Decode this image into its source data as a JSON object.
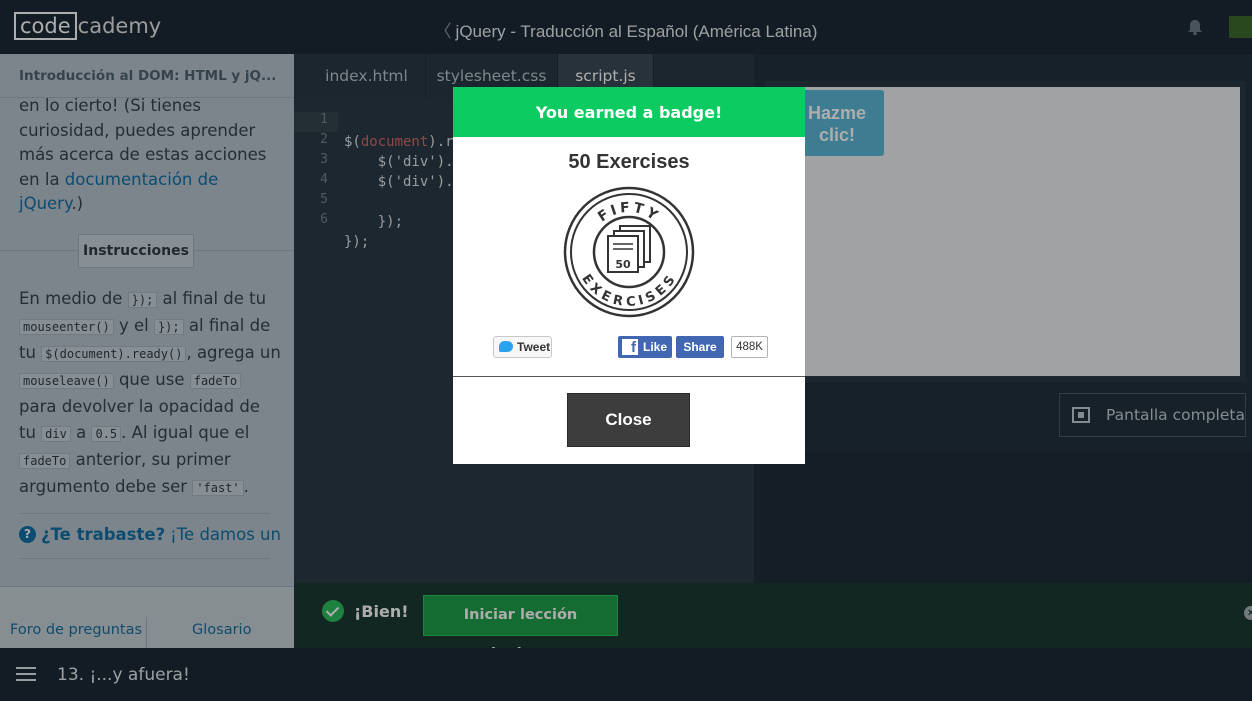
{
  "topbar": {
    "logo_left": "code",
    "logo_right": "cademy",
    "course_title": "jQuery - Traducción al Español (América Latina)",
    "back_chevron": "〈"
  },
  "left_panel": {
    "breadcrumb": "Introducción al DOM: HTML y jQ...",
    "para_text": "en lo cierto! (Si tienes curiosidad, puedes aprender más acerca de estas acciones en la ",
    "para_link": "documentación de jQuery",
    "para_end": ".)",
    "instructions_label": "Instrucciones",
    "instr": {
      "t1": "En medio de ",
      "c1": "});",
      "t2": " al final de tu ",
      "c2": "mouseenter()",
      "t3": " y el ",
      "c3": "});",
      "t4": " al final de tu ",
      "c4": "$(document).ready()",
      "t5": ", agrega un ",
      "c5": "mouseleave()",
      "t6": " que use ",
      "c6": "fadeTo",
      "t7": " para devolver la opacidad de tu ",
      "c7": "div",
      "t8": " a ",
      "c8": "0.5",
      "t9": ". Al igual que el ",
      "c9": "fadeTo",
      "t10": " anterior, su primer argumento debe ser ",
      "c10": "'fast'",
      "t11": "."
    },
    "hint_q": "?",
    "hint_bold": "¿Te trabaste?",
    "hint_text": "¡Te damos un",
    "footer_forum": "Foro de preguntas",
    "footer_glossary": "Glosario"
  },
  "editor": {
    "tabs": [
      "index.html",
      "stylesheet.css",
      "script.js"
    ],
    "active_tab": "script.js",
    "line_numbers": [
      "1",
      "2",
      "3",
      "4",
      "5",
      "6"
    ],
    "lines": [
      {
        "pre": "$(",
        "kw": "document",
        "post": ").r"
      },
      {
        "pre": "    $('div').",
        "kw": "",
        "post": ""
      },
      {
        "pre": "    $('div').",
        "kw": "",
        "post": ""
      },
      {
        "pre": "",
        "kw": "",
        "post": ""
      },
      {
        "pre": "    });",
        "kw": "",
        "post": ""
      },
      {
        "pre": "});",
        "kw": "",
        "post": ""
      }
    ]
  },
  "preview": {
    "button_label_1": "Hazme",
    "button_label_2": "clic!",
    "fullscreen_label": "Pantalla completa",
    "button_color": "#5ab7d6"
  },
  "feedback": {
    "status": "¡Bien!",
    "next_label": "Iniciar lección siguiente",
    "close_glyph": "×"
  },
  "bottombar": {
    "lesson_title": "13. ¡...y afuera!"
  },
  "modal": {
    "header": "You earned a badge!",
    "header_color": "#0ccb60",
    "badge_title": "50 Exercises",
    "badge_top_text": "FIFTY",
    "badge_bottom_text": "EXERCISES",
    "badge_number": "50",
    "tweet_label": "Tweet",
    "like_label": "Like",
    "share_label": "Share",
    "share_count": "488K",
    "close_label": "Close"
  }
}
